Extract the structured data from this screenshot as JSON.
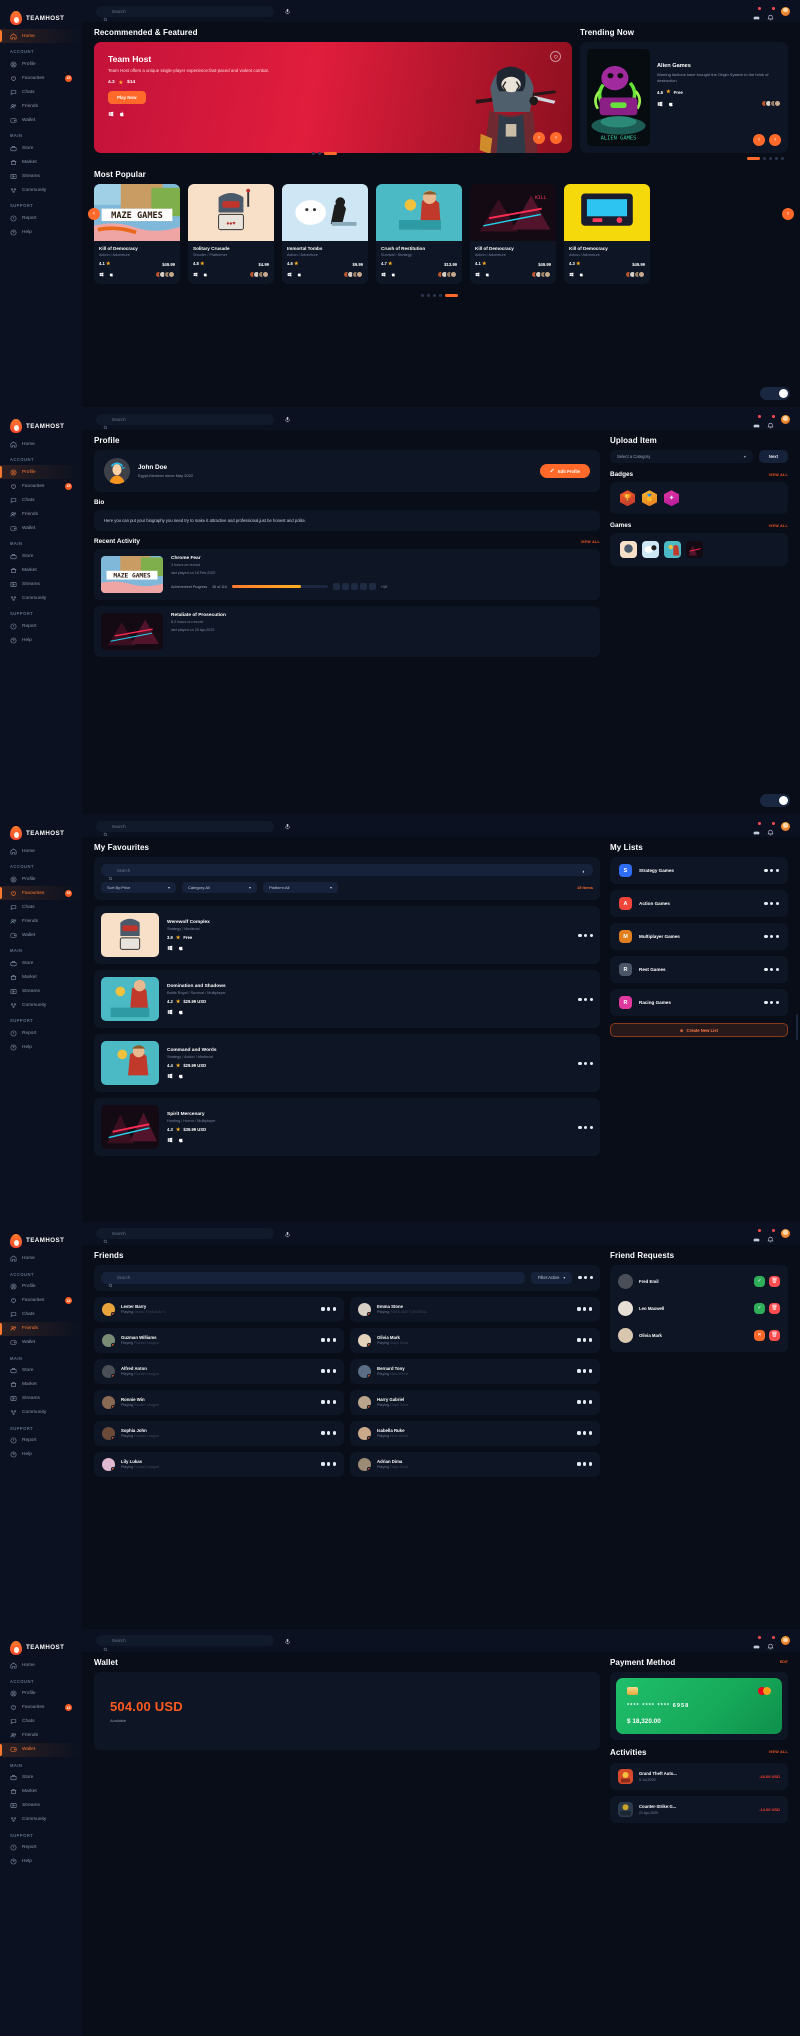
{
  "brand": {
    "name": "TEAMHOST",
    "logo_icon": "flame-icon",
    "accent": "#ff6a2b"
  },
  "search": {
    "placeholder": "Search",
    "value": "",
    "mic_icon": "microphone-icon"
  },
  "sidebar": {
    "sections": [
      {
        "label": "",
        "items": [
          {
            "label": "Home",
            "icon": "home-icon"
          }
        ]
      },
      {
        "label": "ACCOUNT",
        "items": [
          {
            "label": "Profile",
            "icon": "user-circle-icon"
          },
          {
            "label": "Favourites",
            "icon": "heart-icon",
            "badge": "15"
          },
          {
            "label": "Chats",
            "icon": "chat-icon"
          },
          {
            "label": "Friends",
            "icon": "friends-icon"
          },
          {
            "label": "Wallet",
            "icon": "wallet-icon"
          }
        ]
      },
      {
        "label": "MAIN",
        "items": [
          {
            "label": "Store",
            "icon": "store-icon"
          },
          {
            "label": "Market",
            "icon": "market-icon"
          },
          {
            "label": "Streams",
            "icon": "stream-icon"
          },
          {
            "label": "Community",
            "icon": "community-icon"
          }
        ]
      },
      {
        "label": "SUPPORT",
        "items": [
          {
            "label": "Report",
            "icon": "report-icon"
          },
          {
            "label": "Help",
            "icon": "help-icon"
          }
        ]
      }
    ]
  },
  "topbar": {
    "icons": [
      "controller-icon",
      "bell-icon"
    ],
    "avatar": "user-avatar"
  },
  "home": {
    "recommended_title": "Recommended & Featured",
    "trending_title": "Trending Now",
    "hero": {
      "title": "Team Host",
      "description": "Team Host offers a unique single-player experience:fast-paced and violent combat.",
      "rating": "4.3",
      "price": "$14",
      "cta": "Play Now",
      "platforms": [
        "windows-icon",
        "apple-icon"
      ],
      "favorite_icon": "heart-outline-icon"
    },
    "trending": {
      "title": "Alien Games",
      "description": "Warring factions have brought the Origin System to the brink of destruction.",
      "rating": "4.5",
      "price": "Free",
      "art_caption": "ALIEN GAMES",
      "platforms": [
        "windows-icon",
        "apple-icon"
      ]
    },
    "most_popular_title": "Most Popular",
    "games": [
      {
        "name": "Kill of Democracy",
        "genre": "Action / Adventure",
        "rating": "4.1",
        "price": "$49.99",
        "art": "maze-games"
      },
      {
        "name": "Solitary Crusade",
        "genre": "Shooter / Platformer",
        "rating": "4.8",
        "price": "$4.99",
        "art": "cards-skull"
      },
      {
        "name": "Immortal Tombs",
        "genre": "Action / Adventure",
        "rating": "4.6",
        "price": "$9.99",
        "art": "snow-scene"
      },
      {
        "name": "Crush of Restitution",
        "genre": "Survival / Strategy",
        "rating": "4.7",
        "price": "$13.99",
        "art": "builder-scene"
      },
      {
        "name": "Kill of Democracy",
        "genre": "Action / Adventure",
        "rating": "4.1",
        "price": "$49.99",
        "art": "neon-city"
      },
      {
        "name": "Kill of Democracy",
        "genre": "Action / Adventure",
        "rating": "4.3",
        "price": "$49.99",
        "art": "arcade-yellow"
      }
    ]
  },
  "profile": {
    "title": "Profile",
    "user": {
      "name": "John Doe",
      "meta": "Egypt,Member since May 2022",
      "edit_label": "Edit Profile",
      "edit_icon": "pencil-icon"
    },
    "bio_title": "Bio",
    "bio_text": "Here you can put your biography you need try to make it attractive and professional,just be honest and polite.",
    "recent_title": "Recent Activity",
    "view_all": "VIEW ALL",
    "activities": [
      {
        "name": "Chrome Fear",
        "hours": "3 hours on record",
        "last": "last played on 18 Feb,2022",
        "progress_label": "Achievement Progress",
        "progress_value": "36 of 110",
        "extra": "+10"
      },
      {
        "name": "Retaliate of Prosecution",
        "hours": "8.2 hours on record",
        "last": "last played on 25 Apr,2022"
      }
    ],
    "upload_title": "Upload Item",
    "select_placeholder": "Select a Category",
    "next_label": "Next",
    "badges_title": "Badges",
    "badges": [
      "trophy-badge",
      "medal-badge",
      "star-badge"
    ],
    "games_title": "Games"
  },
  "favourites": {
    "title": "My Favourites",
    "search_placeholder": "Search",
    "sort_label": "Sort By:Price",
    "category_label": "Category:All",
    "platform_label": "Platform:All",
    "items_count": "15 Items",
    "items": [
      {
        "name": "Werewolf Complex",
        "genre": "Strategy / Medieval",
        "rating": "3.9",
        "price": "Free",
        "art": "cards-skull"
      },
      {
        "name": "Domination and Shadows",
        "genre": "Battle Royal / Survival / Multiplayer",
        "rating": "4.2",
        "price": "$29.99 USD",
        "art": "builder-scene"
      },
      {
        "name": "Command and Words",
        "genre": "Strategy / Action / Medieval",
        "rating": "4.4",
        "price": "$29.99 USD",
        "art": "teal-scene"
      },
      {
        "name": "Spirit Mercenary",
        "genre": "Hunting / Horror / Multiplayer",
        "rating": "4.3",
        "price": "$39.99 USD",
        "art": "neon-city"
      }
    ],
    "lists_title": "My Lists",
    "lists": [
      {
        "label": "Strategy Games",
        "initial": "S",
        "color": "#2f6df6"
      },
      {
        "label": "Action Games",
        "initial": "A",
        "color": "#f0453a"
      },
      {
        "label": "Multiplayer Games",
        "initial": "M",
        "color": "#e07f1e"
      },
      {
        "label": "Rest Games",
        "initial": "R",
        "color": "#4a5568"
      },
      {
        "label": "Racing Games",
        "initial": "R",
        "color": "#e0399e"
      }
    ],
    "create_label": "Create New List",
    "create_icon": "plus-circle-icon"
  },
  "friends": {
    "title": "Friends",
    "search_placeholder": "Search",
    "filter_label": "Filter:Active",
    "list": [
      {
        "name": "Lester Barry",
        "status": "Playing",
        "game": "Grand Theft Auto V"
      },
      {
        "name": "Emma Stone",
        "status": "Playing",
        "game": "PUBG BATTLEGROU..."
      },
      {
        "name": "Guzman Williams",
        "status": "Playing",
        "game": "Rocket League"
      },
      {
        "name": "Olivia Mark",
        "status": "Playing",
        "game": "Days Gone"
      },
      {
        "name": "Alfred Anton",
        "status": "Playing",
        "game": "Rocket League"
      },
      {
        "name": "Bernard Tony",
        "status": "Playing",
        "game": "New World"
      },
      {
        "name": "Ronnie Win",
        "status": "Playing",
        "game": "Rocket League"
      },
      {
        "name": "Harry Gabriel",
        "status": "Playing",
        "game": "Days Gone"
      },
      {
        "name": "Sophia John",
        "status": "Playing",
        "game": "Rocket League"
      },
      {
        "name": "Isabella Ruke",
        "status": "Playing",
        "game": "New World"
      },
      {
        "name": "Lily Lukas",
        "status": "Playing",
        "game": "Rocket League"
      },
      {
        "name": "Adrian Dima",
        "status": "Playing",
        "game": "Days Gone"
      }
    ],
    "requests_title": "Friend Requests",
    "requests": [
      {
        "name": "Fred Emil",
        "accept_icon": "check-icon",
        "decline_icon": "trash-icon",
        "accept_color": "#2fae5a"
      },
      {
        "name": "Leo Maxwell",
        "accept_icon": "check-icon",
        "decline_icon": "trash-icon",
        "accept_color": "#2fae5a"
      },
      {
        "name": "Olivia Mark",
        "accept_icon": "close-icon",
        "decline_icon": "trash-icon",
        "accept_color": "#ff6a2b"
      }
    ]
  },
  "wallet": {
    "title": "Wallet",
    "balance": "504.00 USD",
    "balance_sub": "Available",
    "payment_title": "Payment Method",
    "edit_label": "EDIT",
    "card": {
      "chip": "chip-icon",
      "logo": "card-logo",
      "number": "**** **** **** 6958",
      "amount": "$ 18,320.00"
    },
    "activities_title": "Activities",
    "view_all": "VIEW ALL",
    "activities": [
      {
        "name": "Grand Theft Auto...",
        "date": "5 Jul,2020",
        "amount": "-44.00 USD"
      },
      {
        "name": "Counter-Strike:G...",
        "date": "21 Apr,2020",
        "amount": "-14.00 USD"
      }
    ]
  }
}
